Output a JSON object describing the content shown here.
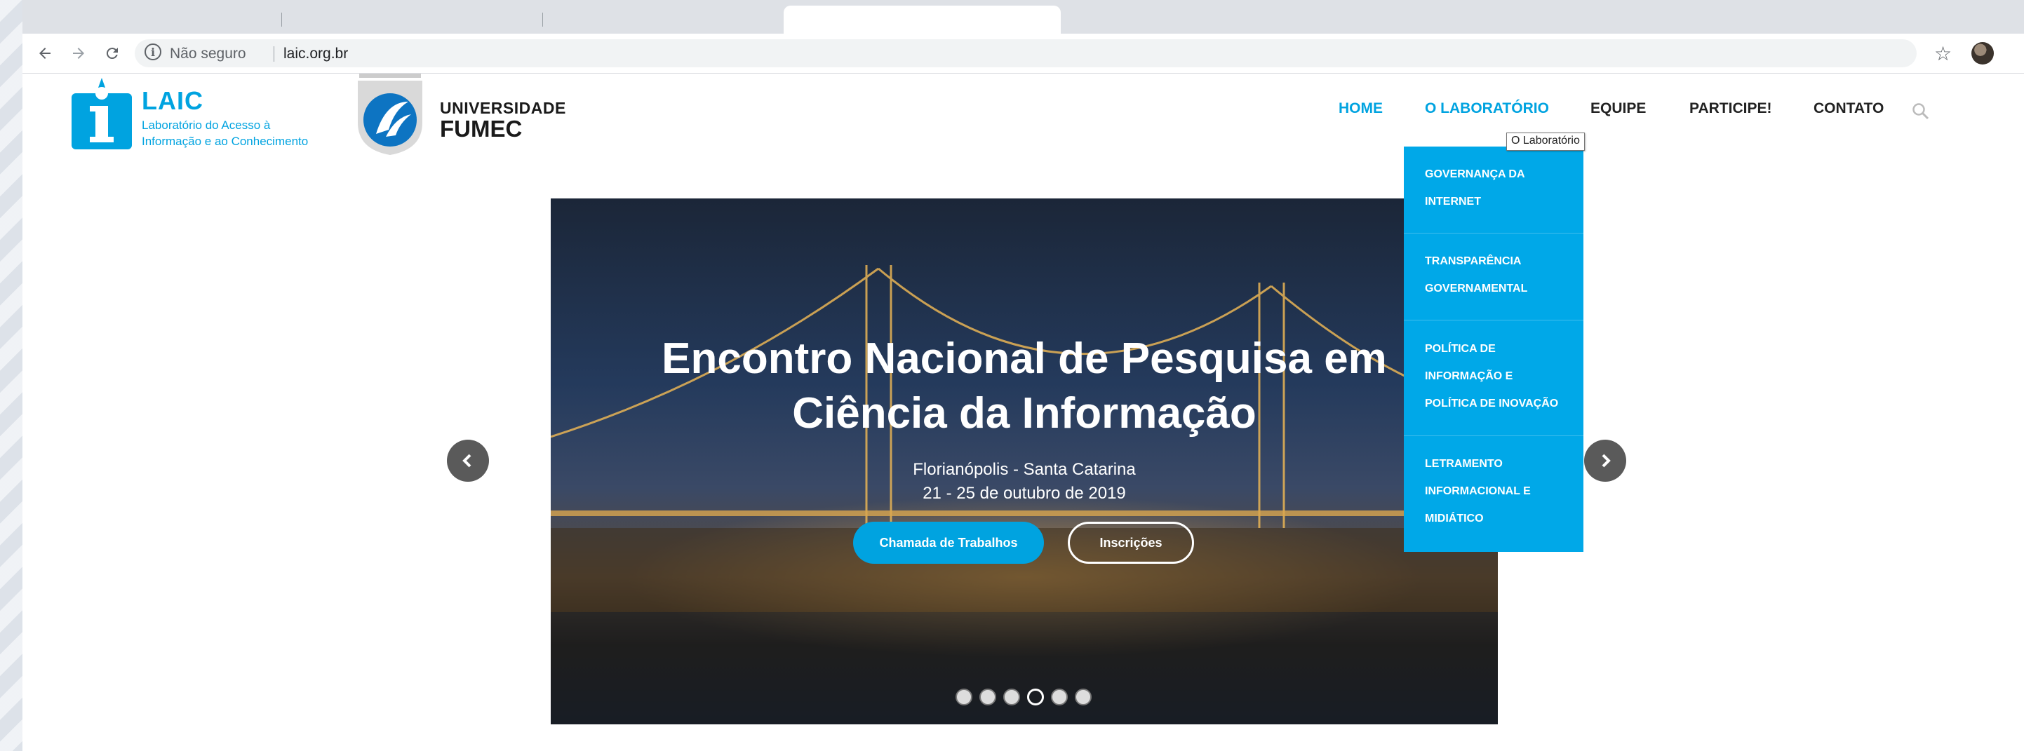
{
  "browser": {
    "security_label": "Não seguro",
    "url": "laic.org.br"
  },
  "header": {
    "laic_title": "LAIC",
    "laic_subtitle_line1": "Laboratório do Acesso à",
    "laic_subtitle_line2": "Informação e ao Conhecimento",
    "fumec_line1": "UNIVERSIDADE",
    "fumec_line2": "FUMEC"
  },
  "nav": {
    "items": [
      {
        "label": "HOME",
        "active": true
      },
      {
        "label": "O LABORATÓRIO",
        "active": true
      },
      {
        "label": "EQUIPE",
        "active": false
      },
      {
        "label": "PARTICIPE!",
        "active": false
      },
      {
        "label": "CONTATO",
        "active": false
      }
    ],
    "tooltip": "O Laboratório"
  },
  "dropdown": {
    "items": [
      {
        "lines": [
          "GOVERNANÇA DA",
          "INTERNET"
        ]
      },
      {
        "lines": [
          "TRANSPARÊNCIA",
          "GOVERNAMENTAL"
        ]
      },
      {
        "lines": [
          "POLÍTICA DE",
          "INFORMAÇÃO E",
          "POLÍTICA DE INOVAÇÃO"
        ]
      },
      {
        "lines": [
          "LETRAMENTO",
          "INFORMACIONAL E",
          "MIDIÁTICO"
        ]
      }
    ]
  },
  "slider": {
    "title_line1": "Encontro Nacional de Pesquisa em",
    "title_line2": "Ciência da Informação",
    "location": "Florianópolis - Santa Catarina",
    "dates": "21 - 25 de outubro de 2019",
    "primary_button": "Chamada de Trabalhos",
    "secondary_button": "Inscrições",
    "slide_count": 6,
    "active_slide": 4
  },
  "colors": {
    "accent": "#00a3e0",
    "dropdown_bg": "#00a8e8"
  }
}
